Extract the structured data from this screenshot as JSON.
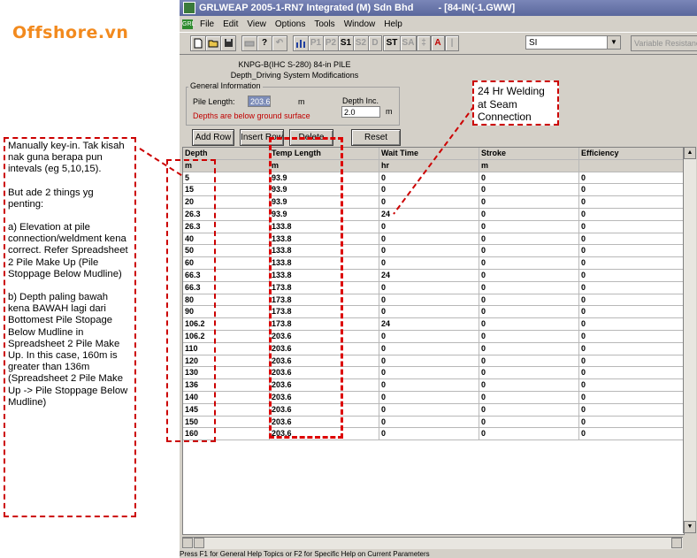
{
  "logo": "Offshore.vn",
  "window": {
    "title": "GRLWEAP 2005-1-RN7 Integrated (M) Sdn Bhd",
    "doc": "- [84-IN(-1.GWW]",
    "menu": [
      "File",
      "Edit",
      "View",
      "Options",
      "Tools",
      "Window",
      "Help"
    ],
    "menu_icon": "GRL"
  },
  "toolbar": {
    "buttons": [
      "P1",
      "P2",
      "S1",
      "S2",
      "D",
      "ST",
      "SA",
      "A",
      "|"
    ],
    "units": "SI",
    "variable_resistance": "Variable Resistance"
  },
  "pile": {
    "title": "KNPG-B(IHC S-280) 84-in PILE",
    "subtitle": "Depth_Driving System Modifications"
  },
  "general": {
    "legend": "General Information",
    "pile_length_label": "Pile Length:",
    "pile_length_value": "203.6",
    "pile_length_unit": "m",
    "depth_inc_label": "Depth Inc.",
    "depth_inc_value": "2.0",
    "depth_inc_unit": "m",
    "note": "Depths are below ground surface"
  },
  "buttons": {
    "add_row": "Add Row",
    "insert_row": "Insert Row",
    "delete_row": "Delete Row",
    "reset": "Reset"
  },
  "table": {
    "columns": [
      "Depth",
      "Temp Length",
      "Wait Time",
      "Stroke",
      "Efficiency"
    ],
    "units": [
      "m",
      "m",
      "hr",
      "m",
      ""
    ],
    "rows": [
      [
        "5",
        "93.9",
        "0",
        "0",
        "0"
      ],
      [
        "15",
        "93.9",
        "0",
        "0",
        "0"
      ],
      [
        "20",
        "93.9",
        "0",
        "0",
        "0"
      ],
      [
        "26.3",
        "93.9",
        "24",
        "0",
        "0"
      ],
      [
        "26.3",
        "133.8",
        "0",
        "0",
        "0"
      ],
      [
        "40",
        "133.8",
        "0",
        "0",
        "0"
      ],
      [
        "50",
        "133.8",
        "0",
        "0",
        "0"
      ],
      [
        "60",
        "133.8",
        "0",
        "0",
        "0"
      ],
      [
        "66.3",
        "133.8",
        "24",
        "0",
        "0"
      ],
      [
        "66.3",
        "173.8",
        "0",
        "0",
        "0"
      ],
      [
        "80",
        "173.8",
        "0",
        "0",
        "0"
      ],
      [
        "90",
        "173.8",
        "0",
        "0",
        "0"
      ],
      [
        "106.2",
        "173.8",
        "24",
        "0",
        "0"
      ],
      [
        "106.2",
        "203.6",
        "0",
        "0",
        "0"
      ],
      [
        "110",
        "203.6",
        "0",
        "0",
        "0"
      ],
      [
        "120",
        "203.6",
        "0",
        "0",
        "0"
      ],
      [
        "130",
        "203.6",
        "0",
        "0",
        "0"
      ],
      [
        "136",
        "203.6",
        "0",
        "0",
        "0"
      ],
      [
        "140",
        "203.6",
        "0",
        "0",
        "0"
      ],
      [
        "145",
        "203.6",
        "0",
        "0",
        "0"
      ],
      [
        "150",
        "203.6",
        "0",
        "0",
        "0"
      ],
      [
        "160",
        "203.6",
        "0",
        "0",
        "0"
      ]
    ]
  },
  "status": "Press F1 for General Help Topics or F2 for Specific Help on Current Parameters",
  "annotations": {
    "left": [
      "Manually key-in. Tak kisah nak guna berapa pun intevals (eg 5,10,15).",
      "But ade 2 things yg penting:",
      "a) Elevation at pile connection/weldment kena correct. Refer Spreadsheet 2 Pile Make Up (Pile Stoppage Below Mudline)",
      "b) Depth paling bawah kena BAWAH lagi dari Bottomest Pile Stopage Below Mudline in Spreadsheet 2 Pile Make Up. In this case, 160m is greater than 136m (Spreadsheet 2 Pile Make Up -> Pile Stoppage Below Mudline)"
    ],
    "right": "24 Hr Welding at Seam Connection"
  },
  "colors": {
    "annotation": "#cc0000",
    "logo": "#f28a1e",
    "titlebar": "#6a76ab"
  }
}
